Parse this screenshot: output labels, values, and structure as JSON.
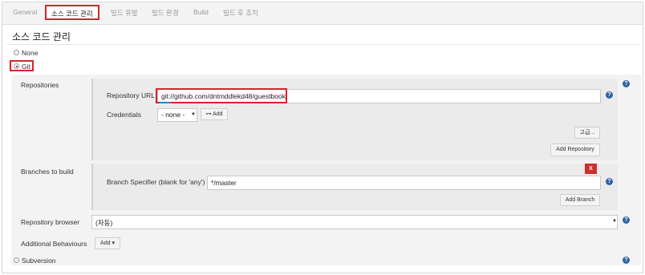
{
  "tabs": [
    {
      "label": "General"
    },
    {
      "label": "소스 코드 관리"
    },
    {
      "label": "빌드 유발"
    },
    {
      "label": "빌드 환경"
    },
    {
      "label": "Build"
    },
    {
      "label": "빌드 후 조치"
    }
  ],
  "section_title": "소스 코드 관리",
  "scm_options": {
    "none_label": "None",
    "git_label": "Git",
    "subversion_label": "Subversion",
    "selected": "Git"
  },
  "git": {
    "repositories_label": "Repositories",
    "repository_url_label": "Repository URL",
    "repository_url_value": "git://github.com/dntmddlekd48/guestbook",
    "credentials_label": "Credentials",
    "credentials_value": "- none -",
    "add_credentials_label": "Add",
    "advanced_button": "고급...",
    "add_repository_button": "Add Repository",
    "branches_label": "Branches to build",
    "branch_specifier_label": "Branch Specifier (blank for 'any')",
    "branch_specifier_value": "*/master",
    "delete_branch_button": "X",
    "add_branch_button": "Add Branch",
    "repository_browser_label": "Repository browser",
    "repository_browser_value": "(자동)",
    "additional_behaviours_label": "Additional Behaviours",
    "add_behaviour_button": "Add"
  },
  "help_icon_text": "?",
  "colors": {
    "highlight_red": "#d9232b",
    "help_blue": "#2d62a8",
    "delete_red": "#c9302c"
  }
}
